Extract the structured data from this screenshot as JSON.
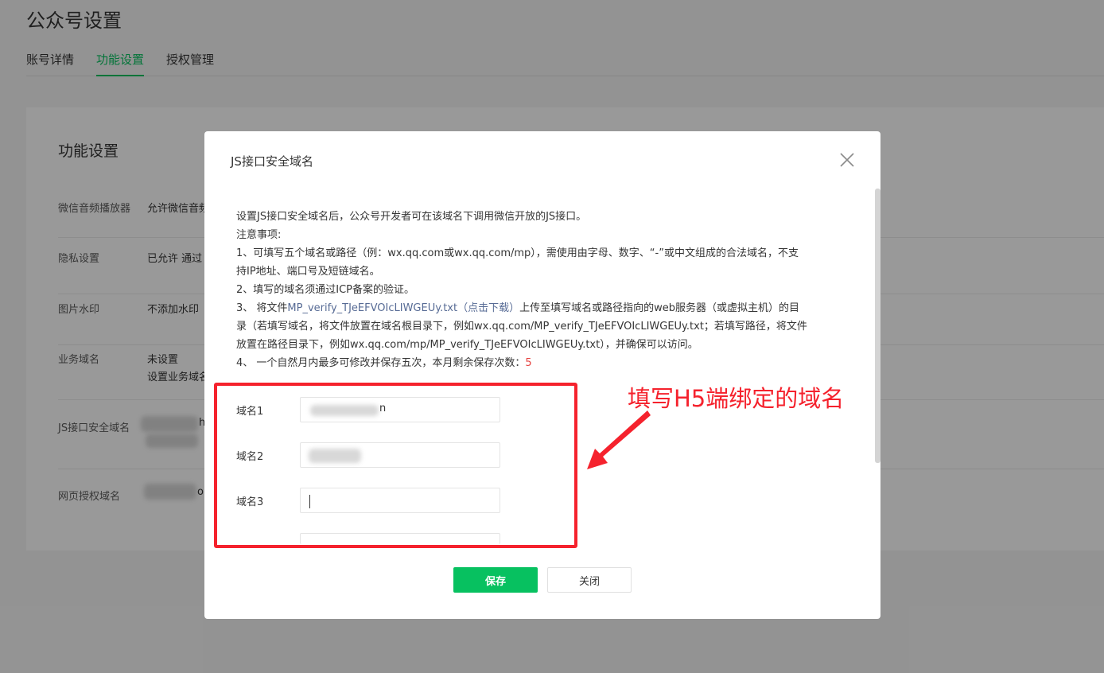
{
  "page": {
    "title": "公众号设置",
    "tabs": [
      {
        "label": "账号详情",
        "active": false
      },
      {
        "label": "功能设置",
        "active": true
      },
      {
        "label": "授权管理",
        "active": false
      }
    ]
  },
  "card": {
    "title": "功能设置",
    "rows": [
      {
        "label": "微信音频播放器",
        "value": "允许微信音频"
      },
      {
        "label": "隐私设置",
        "value": "已允许 通过"
      },
      {
        "label": "图片水印",
        "value": "不添加水印"
      },
      {
        "label": "业务域名",
        "value": "未设置",
        "value2": "设置业务域名"
      },
      {
        "label": "JS接口安全域名",
        "value": "h"
      },
      {
        "label": "网页授权域名",
        "value": "o"
      }
    ]
  },
  "dialog": {
    "title": "JS接口安全域名",
    "lines": {
      "l1": "设置JS接口安全域名后，公众号开发者可在该域名下调用微信开放的JS接口。",
      "l2": "注意事项:",
      "l3": "1、可填写五个域名或路径（例：wx.qq.com或wx.qq.com/mp），需使用由字母、数字、“-”或中文组成的合法域名，不支",
      "l4": "持IP地址、端口号及短链域名。",
      "l5": "2、填写的域名须通过ICP备案的验证。",
      "l6_pre": "3、 将文件",
      "l6_link": "MP_verify_TJeEFVOIcLIWGEUy.txt（点击下载）",
      "l6_post": "上传至填写域名或路径指向的web服务器（或虚拟主机）的目",
      "l7": "录（若填写域名，将文件放置在域名根目录下，例如wx.qq.com/MP_verify_TJeEFVOIcLIWGEUy.txt；若填写路径，将文件",
      "l8": "放置在路径目录下，例如wx.qq.com/mp/MP_verify_TJeEFVOIcLIWGEUy.txt），并确保可以访问。",
      "l9_pre": "4、 一个自然月内最多可修改并保存五次，本月剩余保存次数：",
      "l9_count": "5"
    },
    "fields": [
      {
        "label": "域名1",
        "value_suffix": "n"
      },
      {
        "label": "域名2",
        "value_suffix": ""
      },
      {
        "label": "域名3",
        "value_suffix": ""
      }
    ],
    "save_label": "保存",
    "close_label": "关闭"
  },
  "annotation": {
    "text": "填写H5端绑定的域名",
    "color": "#f5222d"
  },
  "colors": {
    "accent": "#07c160",
    "link": "#576b95",
    "warning": "#e64340"
  }
}
